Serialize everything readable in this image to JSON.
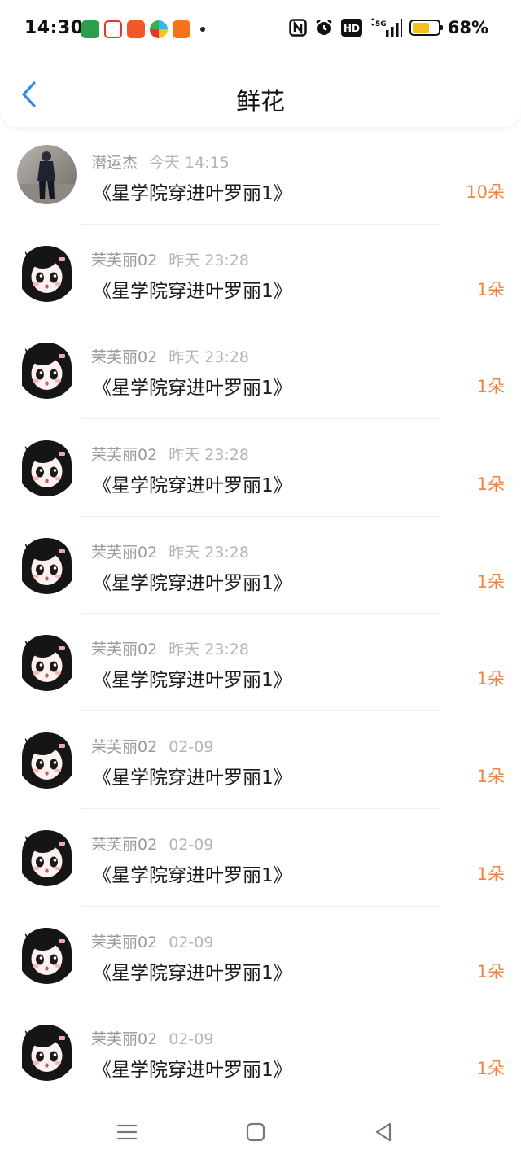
{
  "status_bar": {
    "time": "14:30",
    "battery_text": "68%",
    "battery_level": 0.68,
    "network_label": "5G",
    "hd_label": "HD",
    "nfc_label": "N",
    "notification_icons": [
      {
        "name": "oppo-app-icon",
        "color": "#2e9d4a"
      },
      {
        "name": "toutiao-icon",
        "color": "#e8342c"
      },
      {
        "name": "instagram-like-icon",
        "color": "#f0582a"
      },
      {
        "name": "pinwheel-icon",
        "color": "#3bb3f0"
      },
      {
        "name": "orange-app-icon",
        "color": "#f5731e"
      }
    ]
  },
  "header": {
    "title": "鲜花",
    "accent_color": "#2e8df0"
  },
  "records": [
    {
      "user": "潜运杰",
      "time": "今天 14:15",
      "book": "《星学院穿进叶罗丽1》",
      "count": "10朵",
      "avatar": "photo"
    },
    {
      "user": "茉芙丽02",
      "time": "昨天 23:28",
      "book": "《星学院穿进叶罗丽1》",
      "count": "1朵",
      "avatar": "anime"
    },
    {
      "user": "茉芙丽02",
      "time": "昨天 23:28",
      "book": "《星学院穿进叶罗丽1》",
      "count": "1朵",
      "avatar": "anime"
    },
    {
      "user": "茉芙丽02",
      "time": "昨天 23:28",
      "book": "《星学院穿进叶罗丽1》",
      "count": "1朵",
      "avatar": "anime"
    },
    {
      "user": "茉芙丽02",
      "time": "昨天 23:28",
      "book": "《星学院穿进叶罗丽1》",
      "count": "1朵",
      "avatar": "anime"
    },
    {
      "user": "茉芙丽02",
      "time": "昨天 23:28",
      "book": "《星学院穿进叶罗丽1》",
      "count": "1朵",
      "avatar": "anime"
    },
    {
      "user": "茉芙丽02",
      "time": "02-09",
      "book": "《星学院穿进叶罗丽1》",
      "count": "1朵",
      "avatar": "anime"
    },
    {
      "user": "茉芙丽02",
      "time": "02-09",
      "book": "《星学院穿进叶罗丽1》",
      "count": "1朵",
      "avatar": "anime"
    },
    {
      "user": "茉芙丽02",
      "time": "02-09",
      "book": "《星学院穿进叶罗丽1》",
      "count": "1朵",
      "avatar": "anime"
    },
    {
      "user": "茉芙丽02",
      "time": "02-09",
      "book": "《星学院穿进叶罗丽1》",
      "count": "1朵",
      "avatar": "anime"
    }
  ],
  "colors": {
    "count": "#ef8540",
    "secondary_text": "#9a9a9a"
  }
}
